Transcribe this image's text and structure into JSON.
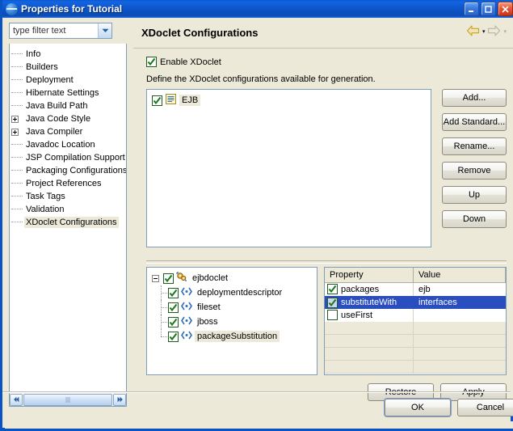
{
  "window": {
    "title": "Properties for Tutorial",
    "icon": "eclipse-globe-icon",
    "minimize_label": "–",
    "maximize_label": "□",
    "close_label": "✕"
  },
  "filter": {
    "value": "type filter text",
    "placeholder": "type filter text",
    "dropdown_icon": "chevron-down-icon"
  },
  "sidebar": {
    "items": [
      {
        "label": "Info",
        "expandable": false,
        "selected": false
      },
      {
        "label": "Builders",
        "expandable": false,
        "selected": false
      },
      {
        "label": "Deployment",
        "expandable": false,
        "selected": false
      },
      {
        "label": "Hibernate Settings",
        "expandable": false,
        "selected": false
      },
      {
        "label": "Java Build Path",
        "expandable": false,
        "selected": false
      },
      {
        "label": "Java Code Style",
        "expandable": true,
        "selected": false
      },
      {
        "label": "Java Compiler",
        "expandable": true,
        "selected": false
      },
      {
        "label": "Javadoc Location",
        "expandable": false,
        "selected": false
      },
      {
        "label": "JSP Compilation Support",
        "expandable": false,
        "selected": false
      },
      {
        "label": "Packaging Configurations",
        "expandable": false,
        "selected": false
      },
      {
        "label": "Project References",
        "expandable": false,
        "selected": false
      },
      {
        "label": "Task Tags",
        "expandable": false,
        "selected": false
      },
      {
        "label": "Validation",
        "expandable": false,
        "selected": false
      },
      {
        "label": "XDoclet Configurations",
        "expandable": false,
        "selected": true
      }
    ],
    "scrollbar": {
      "left_arrow": "«",
      "right_arrow": "»"
    }
  },
  "page": {
    "title": "XDoclet Configurations",
    "nav": {
      "back_icon": "back-arrow-icon",
      "back_caret": "▾",
      "forward_icon": "forward-arrow-icon",
      "forward_caret": "▾"
    },
    "enable_checkbox": {
      "label": "Enable XDoclet",
      "checked": true
    },
    "description": "Define the XDoclet configurations available for generation.",
    "config_list": {
      "items": [
        {
          "label": "EJB",
          "checked": true,
          "icon": "config-document-icon",
          "selected": true
        }
      ]
    },
    "buttons": [
      {
        "label": "Add..."
      },
      {
        "label": "Add Standard..."
      },
      {
        "label": "Rename..."
      },
      {
        "label": "Remove"
      },
      {
        "label": "Up"
      },
      {
        "label": "Down"
      }
    ],
    "sub_tree": {
      "root": {
        "label": "ejbdoclet",
        "checked": true,
        "icon": "gears-icon",
        "expanded": true
      },
      "children": [
        {
          "label": "deploymentdescriptor",
          "checked": true,
          "icon": "tag-icon",
          "selected": false
        },
        {
          "label": "fileset",
          "checked": true,
          "icon": "tag-icon",
          "selected": false
        },
        {
          "label": "jboss",
          "checked": true,
          "icon": "tag-icon",
          "selected": false
        },
        {
          "label": "packageSubstitution",
          "checked": true,
          "icon": "tag-icon",
          "selected": true
        }
      ]
    },
    "property_table": {
      "columns": [
        "Property",
        "Value"
      ],
      "rows": [
        {
          "name": "packages",
          "value": "ejb",
          "checked": true,
          "selected": false
        },
        {
          "name": "substituteWith",
          "value": "interfaces",
          "checked": true,
          "selected": true
        },
        {
          "name": "useFirst",
          "value": "",
          "checked": false,
          "selected": false
        }
      ],
      "empty_row_count": 4
    },
    "restore_defaults_label": "Restore Defaults",
    "apply_label": "Apply"
  },
  "footer": {
    "ok_label": "OK",
    "cancel_label": "Cancel"
  },
  "colors": {
    "title_bar": "#0a53c4",
    "dialog_bg": "#ece9d8",
    "selection_blue": "#2a4ec0",
    "field_bg": "#ffffff",
    "border": "#7f9db9"
  }
}
